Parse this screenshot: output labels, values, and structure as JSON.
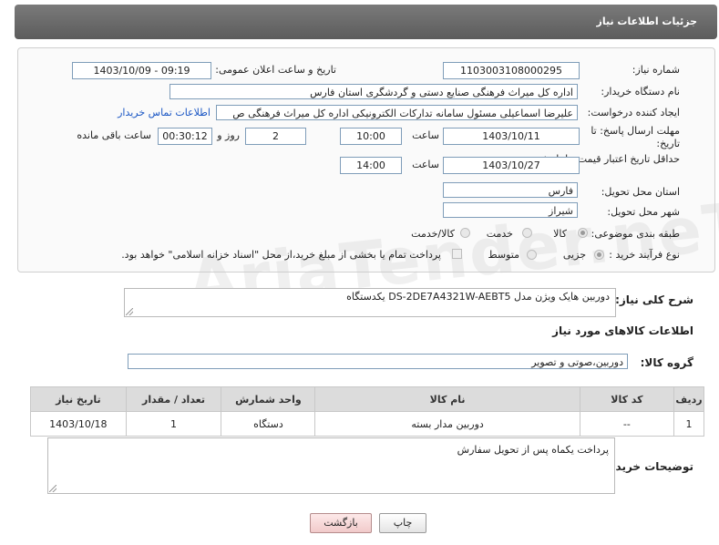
{
  "header": {
    "title": "جزئیات اطلاعات نیاز"
  },
  "form": {
    "need_number": {
      "label": "شماره نیاز:",
      "value": "1103003108000295"
    },
    "announce_datetime": {
      "label": "تاریخ و ساعت اعلان عمومی:",
      "value": "1403/10/09 - 09:19"
    },
    "buyer_org": {
      "label": "نام دستگاه خریدار:",
      "value": "اداره کل میراث فرهنگی  صنایع دستی و گردشگری استان فارس"
    },
    "requester": {
      "label": "ایجاد کننده درخواست:",
      "value": "علیرضا اسماعیلی مسئول سامانه تدارکات الکترونیکی اداره کل میراث فرهنگی  ص",
      "contact_link": "اطلاعات تماس خریدار"
    },
    "reply_deadline": {
      "label": "مهلت ارسال پاسخ: تا تاریخ:",
      "date": "1403/10/11",
      "time_label": "ساعت",
      "time": "10:00",
      "days": "2",
      "days_label": "روز و",
      "remaining": "00:30:12",
      "remaining_label": "ساعت باقی مانده"
    },
    "price_validity": {
      "label": "حداقل تاریخ اعتبار قیمت: تا تاریخ:",
      "date": "1403/10/27",
      "time_label": "ساعت",
      "time": "14:00"
    },
    "delivery_province": {
      "label": "استان محل تحویل:",
      "value": "فارس"
    },
    "delivery_city": {
      "label": "شهر محل تحویل:",
      "value": "شیراز"
    },
    "category": {
      "label": "طبقه بندی موضوعی:",
      "options": [
        "کالا",
        "خدمت",
        "کالا/خدمت"
      ],
      "selected": "کالا"
    },
    "purchase_type": {
      "label": "نوع فرآیند خرید :",
      "options": [
        "جزیی",
        "متوسط"
      ],
      "selected": "جزیی",
      "payment_note": "پرداخت تمام یا بخشی از مبلغ خرید،از محل \"اسناد خزانه اسلامی\" خواهد بود."
    }
  },
  "description": {
    "label": "شرح کلی نیاز:",
    "value": "دوربین هایک ویژن مدل DS-2DE7A4321W-AEBT5  یکدستگاه"
  },
  "goods_section": {
    "title": "اطلاعات کالاهای مورد نیاز",
    "group_label": "گروه کالا:",
    "group_value": "دوربین،صوتی و تصویر"
  },
  "table": {
    "headers": [
      "ردیف",
      "کد کالا",
      "نام کالا",
      "واحد شمارش",
      "تعداد / مقدار",
      "تاریخ نیاز"
    ],
    "rows": [
      [
        "1",
        "--",
        "دوربین مدار بسته",
        "دستگاه",
        "1",
        "1403/10/18"
      ]
    ]
  },
  "buyer_notes": {
    "label": "توضیحات خریدار:",
    "value": "پرداخت یکماه پس از تحویل سفارش"
  },
  "buttons": {
    "print": "چاپ",
    "back": "بازگشت"
  },
  "watermark": "AriaTender.neT",
  "colors": {
    "header_bg": "#6b6b6b",
    "link": "#1a56c4",
    "back_button": "#f1caca"
  }
}
